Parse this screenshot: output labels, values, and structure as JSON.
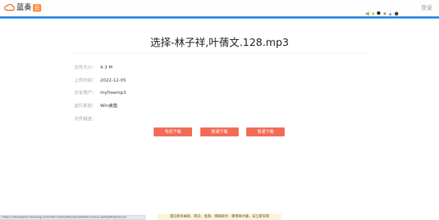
{
  "header": {
    "logo_text": "蓝奏",
    "logo_badge": "云",
    "login_label": "登录"
  },
  "file": {
    "title": "选择-林子祥,叶蒨文.128.mp3",
    "info": [
      {
        "label": "文件大小：",
        "value": "4.3 M"
      },
      {
        "label": "上传时间：",
        "value": "2022-12-05"
      },
      {
        "label": "分享用户：",
        "value": "myfreemp3"
      },
      {
        "label": "运行系统：",
        "value": "Win桌面"
      },
      {
        "label": "文件描述：",
        "value": ""
      }
    ]
  },
  "buttons": {
    "telecom": "电信下载",
    "unicom": "联通下载",
    "normal": "普通下载"
  },
  "status_bar": {
    "url": "https://developer.lanzoug.com/file/?UjVRaAk5AjcIDwAIBTEHa1E1BmJWeIQEVGs4"
  },
  "notice": {
    "text": "遇见刷单兼职、网贷、金融、裸聊敲诈、赌博等诈骗，请立即举报"
  },
  "colors": {
    "accent": "#1f86e5",
    "button": "#f26b57"
  }
}
